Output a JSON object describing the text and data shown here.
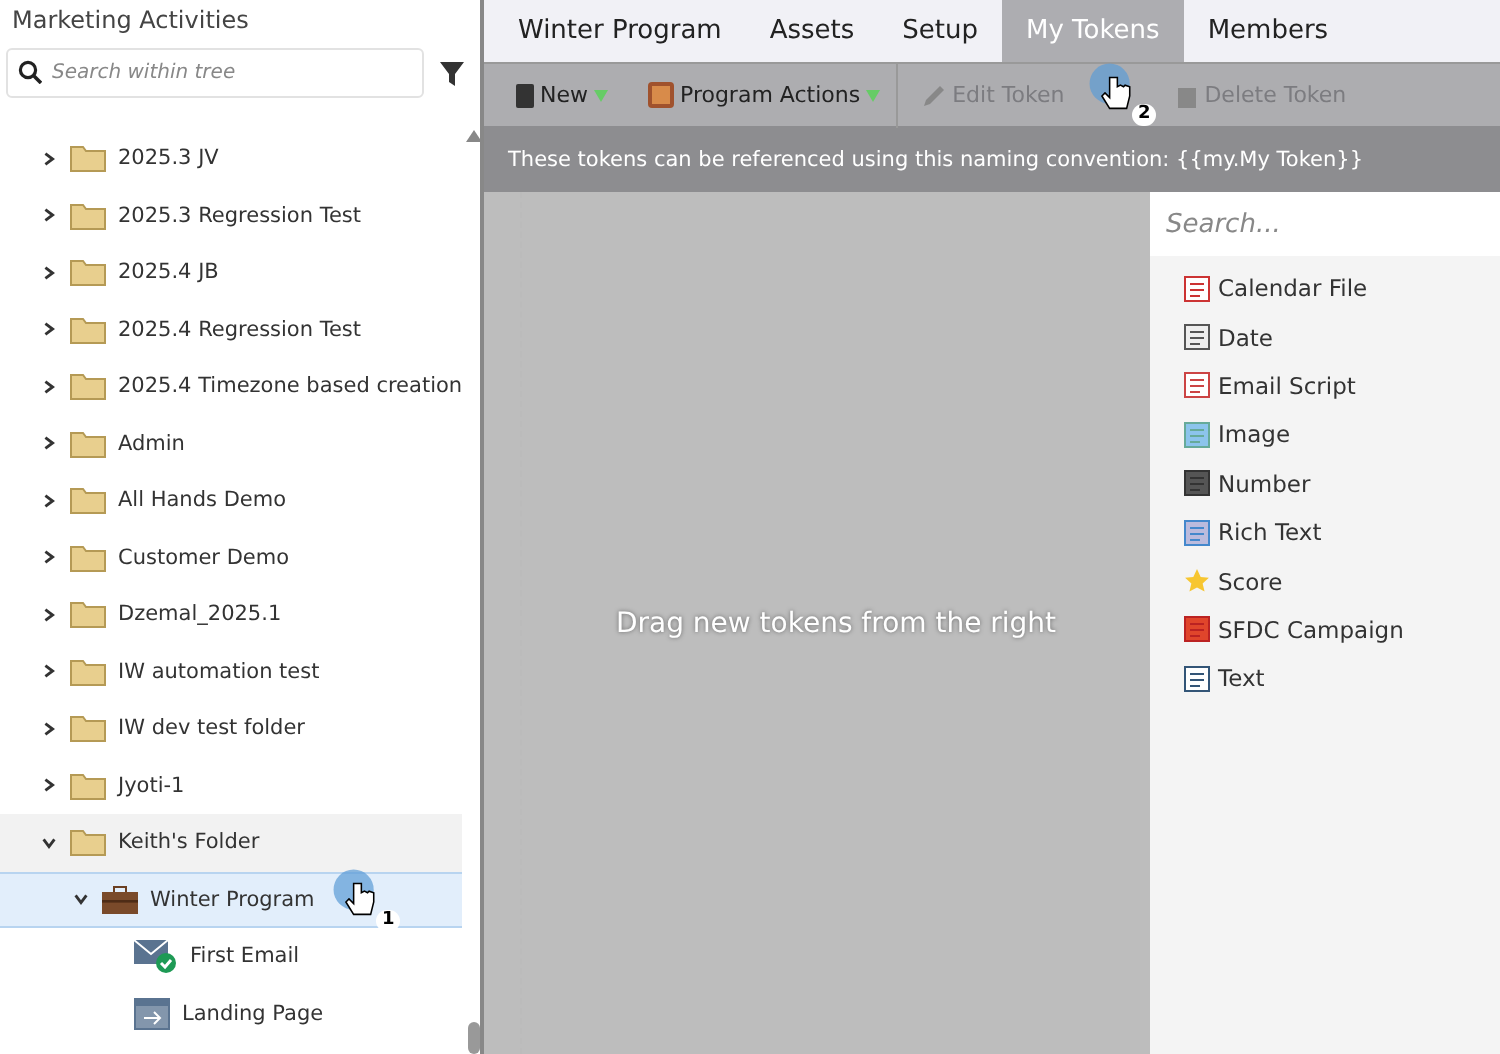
{
  "sidebar": {
    "title": "Marketing Activities",
    "search": {
      "placeholder": "Search within tree"
    },
    "tree": [
      {
        "label": "2025.3 JV",
        "kind": "folder",
        "expanded": false,
        "selected": false
      },
      {
        "label": "2025.3 Regression Test",
        "kind": "folder",
        "expanded": false,
        "selected": false
      },
      {
        "label": "2025.4 JB",
        "kind": "folder",
        "expanded": false,
        "selected": false
      },
      {
        "label": "2025.4 Regression Test",
        "kind": "folder",
        "expanded": false,
        "selected": false
      },
      {
        "label": "2025.4 Timezone based creation",
        "kind": "folder",
        "expanded": false,
        "selected": false
      },
      {
        "label": "Admin",
        "kind": "folder",
        "expanded": false,
        "selected": false
      },
      {
        "label": "All Hands Demo",
        "kind": "folder",
        "expanded": false,
        "selected": false
      },
      {
        "label": "Customer Demo",
        "kind": "folder",
        "expanded": false,
        "selected": false
      },
      {
        "label": "Dzemal_2025.1",
        "kind": "folder",
        "expanded": false,
        "selected": false
      },
      {
        "label": "IW automation test",
        "kind": "folder",
        "expanded": false,
        "selected": false
      },
      {
        "label": "IW dev test folder",
        "kind": "folder",
        "expanded": false,
        "selected": false
      },
      {
        "label": "Jyoti-1",
        "kind": "folder",
        "expanded": false,
        "selected": false
      },
      {
        "label": "Keith's Folder",
        "kind": "folder",
        "expanded": true,
        "selected": false,
        "children": [
          {
            "label": "Winter Program",
            "kind": "program",
            "expanded": true,
            "selected": true,
            "callout": "1",
            "children": [
              {
                "label": "First Email",
                "kind": "email",
                "selected": false
              },
              {
                "label": "Landing Page",
                "kind": "landing",
                "selected": false
              }
            ]
          }
        ]
      }
    ]
  },
  "tabs": [
    {
      "label": "Winter Program",
      "selected": false
    },
    {
      "label": "Assets",
      "selected": false
    },
    {
      "label": "Setup",
      "selected": false
    },
    {
      "label": "My Tokens",
      "selected": true,
      "callout": "2"
    },
    {
      "label": "Members",
      "selected": false
    }
  ],
  "toolbar": [
    {
      "label": "New",
      "kind": "new",
      "disabled": false,
      "dropdown": true
    },
    {
      "label": "Program Actions",
      "kind": "actions",
      "disabled": false,
      "dropdown": true
    },
    {
      "label": "Edit Token",
      "kind": "edit",
      "disabled": true,
      "dropdown": false
    },
    {
      "label": "Delete Token",
      "kind": "delete",
      "disabled": true,
      "dropdown": false
    }
  ],
  "info": "These tokens can be referenced using this naming convention: {{my.My Token}}",
  "drop_zone": "Drag new tokens from the right",
  "palette": {
    "search": {
      "placeholder": "Search..."
    },
    "items": [
      {
        "label": "Calendar File",
        "kind": "calendar"
      },
      {
        "label": "Date",
        "kind": "date"
      },
      {
        "label": "Email Script",
        "kind": "script"
      },
      {
        "label": "Image",
        "kind": "image"
      },
      {
        "label": "Number",
        "kind": "number"
      },
      {
        "label": "Rich Text",
        "kind": "richtext"
      },
      {
        "label": "Score",
        "kind": "score"
      },
      {
        "label": "SFDC Campaign",
        "kind": "sfdc"
      },
      {
        "label": "Text",
        "kind": "text"
      }
    ]
  }
}
